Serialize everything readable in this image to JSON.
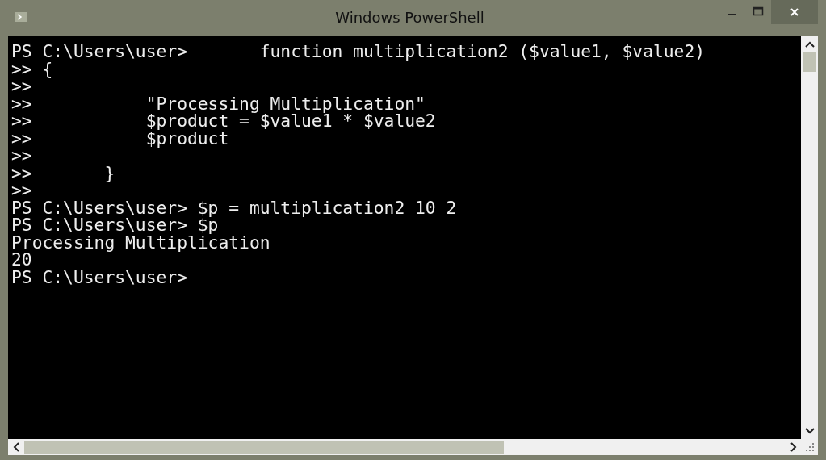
{
  "window": {
    "title": "Windows PowerShell"
  },
  "console": {
    "lines": [
      "PS C:\\Users\\user>       function multiplication2 ($value1, $value2)",
      ">> {",
      ">>",
      ">>           \"Processing Multiplication\"",
      ">>           $product = $value1 * $value2",
      ">>           $product",
      ">>",
      ">>       }",
      ">>",
      "PS C:\\Users\\user> $p = multiplication2 10 2",
      "PS C:\\Users\\user> $p",
      "Processing Multiplication",
      "20",
      "PS C:\\Users\\user>"
    ]
  }
}
